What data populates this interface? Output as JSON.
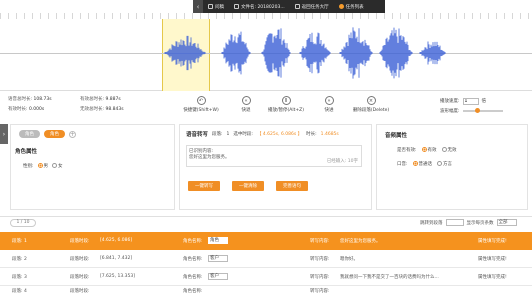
{
  "toolbar": {
    "items": [
      {
        "icon": "document-icon",
        "label": "问稿"
      },
      {
        "icon": "file-icon",
        "label": "文件名: 20180203..."
      },
      {
        "icon": "hall-icon",
        "label": "返回任务大厅"
      },
      {
        "icon": "task-list-icon",
        "label": "任务列表"
      }
    ]
  },
  "stats": {
    "voice_total_label": "语音总时长:",
    "voice_total": "108.73s",
    "valid_label": "有效总时长:",
    "valid": "9.887s",
    "effective_label": "有效时长:",
    "effective": "0.000s",
    "invalid_label": "无效总时长:",
    "invalid": "98.843s"
  },
  "controls": [
    {
      "icon": "return-icon",
      "label": "快捷键(Shift+W)"
    },
    {
      "icon": "back-icon",
      "label": "快退"
    },
    {
      "icon": "pause-icon",
      "label": "播放/暂停(Alt+Z)"
    },
    {
      "icon": "forward-icon",
      "label": "快进"
    },
    {
      "icon": "delete-icon",
      "label": "删除段落(Delete)"
    }
  ],
  "playback": {
    "speed_label": "播放速度:",
    "speed_value": "1",
    "speed_unit": "倍",
    "volume_label": "波形幅度:"
  },
  "role_panel": {
    "tab1": "角色",
    "tab2": "角色",
    "section_title": "角色属性",
    "gender_label": "性别:",
    "gender_opt1": "男",
    "gender_opt2": "女"
  },
  "transcribe_panel": {
    "title": "语音转写",
    "segment_label": "段落:",
    "segment_value": "1",
    "selection_label": "选中时段:",
    "selection_value": "【 4.625s, 6.086s 】",
    "duration_label": "时长:",
    "duration_value": "1.4685s",
    "input_label": "已识别内容:",
    "input_text": "您好这里为您服务。",
    "counter": "已经输入: 10字",
    "btn1": "一键转写",
    "btn2": "一键清除",
    "btn3": "完善语句"
  },
  "attr_panel": {
    "title": "音频属性",
    "valid_label": "是否有效:",
    "valid_opt1": "有效",
    "valid_opt2": "无效",
    "accent_label": "口音:",
    "accent_opt1": "普通话",
    "accent_opt2": "方言"
  },
  "table": {
    "pager": "1 / 10",
    "goto_label": "跳转到段落",
    "per_page_label": "显示每页条数",
    "per_page_value": "全部",
    "rows": [
      {
        "seg": "段落: 1",
        "time_label": "段落时段:",
        "time": "[4.625, 6.086]",
        "role_label": "角色名称:",
        "role": "角色",
        "text_label": "转写内容:",
        "text": "您好这里为您服务。",
        "status": "属性填写完成!"
      },
      {
        "seg": "段落: 2",
        "time_label": "段落时段:",
        "time": "[6.841, 7.432]",
        "role_label": "角色名称:",
        "role": "客户",
        "text_label": "转写内容:",
        "text": "嗯你好。",
        "status": "属性填写完成!"
      },
      {
        "seg": "段落: 3",
        "time_label": "段落时段:",
        "time": "[7.625, 13.353]",
        "role_label": "角色名称:",
        "role": "客户",
        "text_label": "转写内容:",
        "text": "我就想问一下我不是交了一百块的话费吗为什么...",
        "status": "属性填写完成!"
      },
      {
        "seg": "段落: 4",
        "time_label": "段落时段:",
        "time": "",
        "role_label": "角色名称:",
        "role": "",
        "text_label": "转写内容:",
        "text": "",
        "status": ""
      }
    ]
  }
}
